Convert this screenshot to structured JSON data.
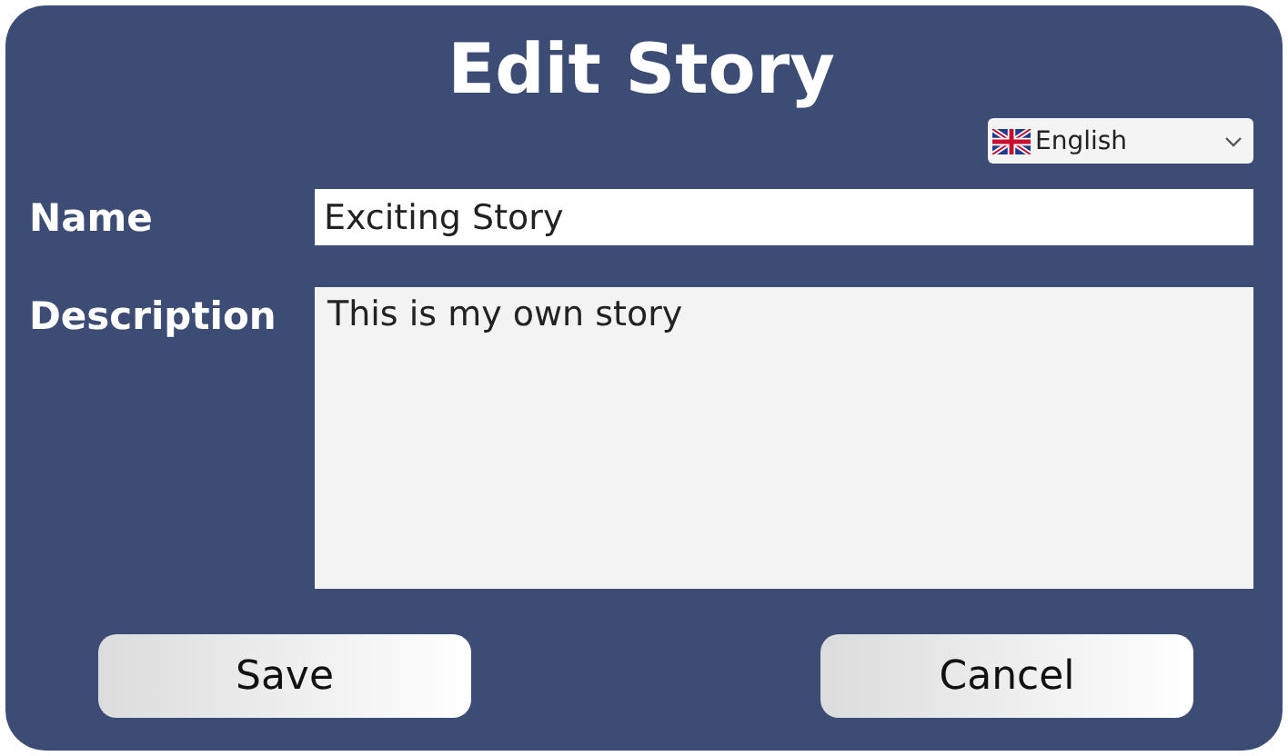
{
  "dialog": {
    "title": "Edit Story"
  },
  "language": {
    "value": "English"
  },
  "fields": [
    {
      "label": "Name",
      "value": "Exciting Story",
      "kind": "line"
    },
    {
      "label": "Description",
      "value": "This is my own story",
      "kind": "area"
    }
  ],
  "buttons": [
    {
      "label": "Save"
    },
    {
      "label": "Cancel"
    }
  ]
}
